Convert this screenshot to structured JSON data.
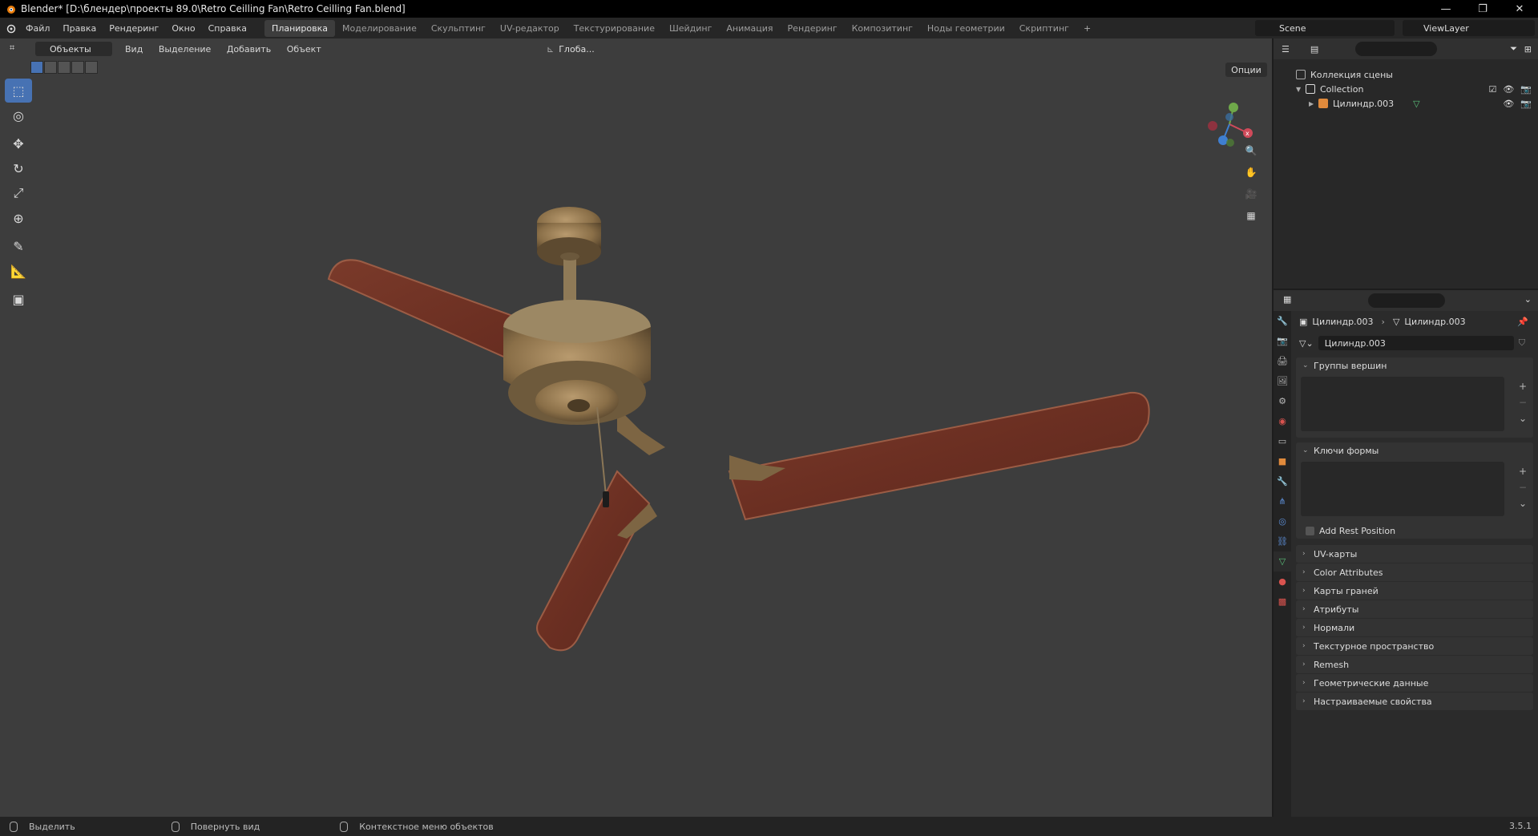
{
  "titlebar": {
    "title": "Blender* [D:\\блендер\\проекты 89.0\\Retro Ceilling Fan\\Retro Ceilling Fan.blend]",
    "min": "—",
    "max": "❐",
    "close": "✕"
  },
  "menu": [
    "Файл",
    "Правка",
    "Рендеринг",
    "Окно",
    "Справка"
  ],
  "workspaces": [
    "Планировка",
    "Моделирование",
    "Скульптинг",
    "UV-редактор",
    "Текстурирование",
    "Шейдинг",
    "Анимация",
    "Рендеринг",
    "Композитинг",
    "Ноды геометрии",
    "Скриптинг"
  ],
  "workspace_add": "+",
  "scene": "Scene",
  "view_layer": "ViewLayer",
  "viewport": {
    "mode": "Объекты",
    "menus": [
      "Вид",
      "Выделение",
      "Добавить",
      "Объект"
    ],
    "orientation": "Глоба...",
    "options": "Опции"
  },
  "outliner": {
    "scene_collection": "Коллекция сцены",
    "collection": "Collection",
    "object": "Цилиндр.003"
  },
  "properties": {
    "crumb_object": "Цилиндр.003",
    "crumb_mesh": "Цилиндр.003",
    "mesh_name": "Цилиндр.003",
    "vertex_groups": "Группы вершин",
    "shape_keys": "Ключи формы",
    "add_rest_position": "Add Rest Position",
    "sections": [
      "UV-карты",
      "Color Attributes",
      "Карты граней",
      "Атрибуты",
      "Нормали",
      "Текстурное пространство",
      "Remesh",
      "Геометрические данные",
      "Настраиваемые свойства"
    ]
  },
  "statusbar": {
    "select": "Выделить",
    "rotate": "Повернуть вид",
    "context": "Контекстное меню объектов",
    "version": "3.5.1"
  },
  "colors": {
    "accent": "#4772b3",
    "viewport_bg": "#3d3d3d",
    "blade": "#6b2f22"
  }
}
